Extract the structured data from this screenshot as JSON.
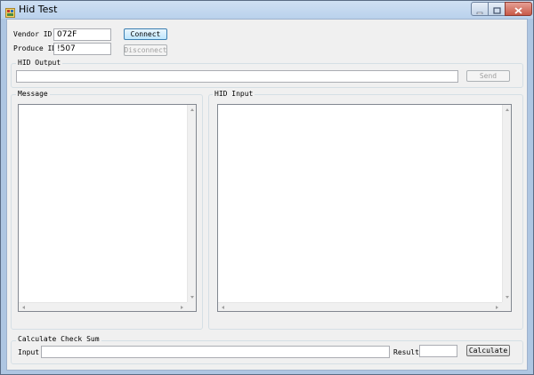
{
  "window": {
    "title": "Hid Test",
    "icons": {
      "app": "app-icon",
      "minimize": "minimize-icon",
      "maximize": "maximize-icon",
      "close": "close-icon"
    }
  },
  "device": {
    "vendor_label": "Vendor ID:",
    "vendor_value": "072F",
    "product_label": "Produce ID:",
    "product_value": "!507",
    "connect_label": "Connect",
    "disconnect_label": "Disconnect"
  },
  "hid_output": {
    "group_label": "HID Output",
    "value": "",
    "send_label": "Send"
  },
  "message": {
    "group_label": "Message",
    "lines": []
  },
  "hid_input": {
    "group_label": "HID Input",
    "lines": []
  },
  "checksum": {
    "group_label": "Calculate Check Sum",
    "input_label": "Input:",
    "input_value": "",
    "result_label": "Result:",
    "result_value": "",
    "calculate_label": "Calculate"
  },
  "colors": {
    "frame": "#aec6e2",
    "client": "#f0f0f0",
    "close_button": "#c85a48"
  }
}
